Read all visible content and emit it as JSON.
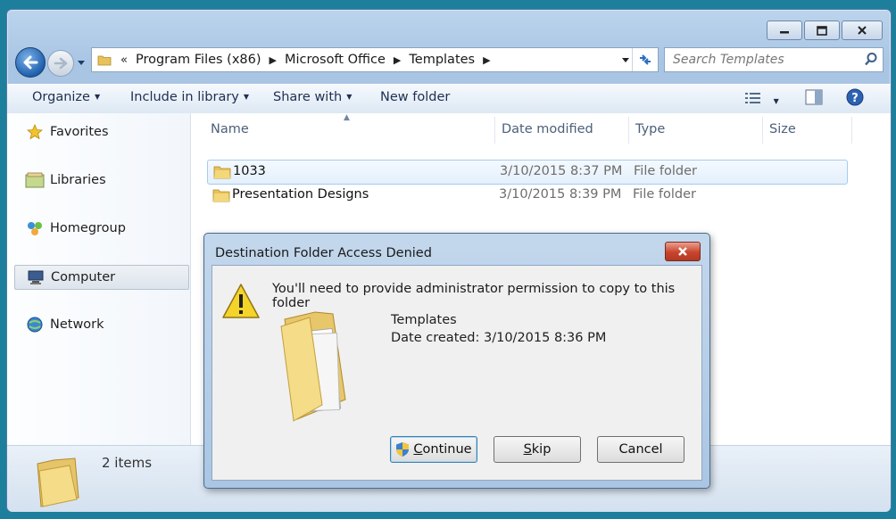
{
  "window": {
    "address": {
      "crumbs": [
        "Program Files (x86)",
        "Microsoft Office",
        "Templates"
      ],
      "overflow": "«"
    },
    "search": {
      "placeholder": "Search Templates"
    },
    "toolbar": {
      "organize": "Organize",
      "include_in_library": "Include in library",
      "share_with": "Share with",
      "new_folder": "New folder"
    },
    "nav": {
      "items": [
        {
          "label": "Favorites",
          "icon": "star-icon"
        },
        {
          "label": "Libraries",
          "icon": "libraries-icon"
        },
        {
          "label": "Homegroup",
          "icon": "homegroup-icon"
        },
        {
          "label": "Computer",
          "icon": "computer-icon",
          "selected": true
        },
        {
          "label": "Network",
          "icon": "network-icon"
        }
      ]
    },
    "columns": {
      "name": "Name",
      "date_modified": "Date modified",
      "type": "Type",
      "size": "Size"
    },
    "files": [
      {
        "name": "1033",
        "date": "3/10/2015 8:37 PM",
        "type": "File folder"
      },
      {
        "name": "Presentation Designs",
        "date": "3/10/2015 8:39 PM",
        "type": "File folder"
      }
    ],
    "details": {
      "count": "2 items"
    }
  },
  "dialog": {
    "title": "Destination Folder Access Denied",
    "message": "You'll need to provide administrator permission to copy to this folder",
    "folder_name": "Templates",
    "folder_date": "Date created: 3/10/2015 8:36 PM",
    "buttons": {
      "continue_first": "C",
      "continue_rest": "ontinue",
      "skip_first": "S",
      "skip_rest": "kip",
      "cancel": "Cancel"
    }
  },
  "colors": {
    "accent": "#1d7f9c",
    "selection": "#e4f0fc",
    "close_red": "#c9442c"
  }
}
